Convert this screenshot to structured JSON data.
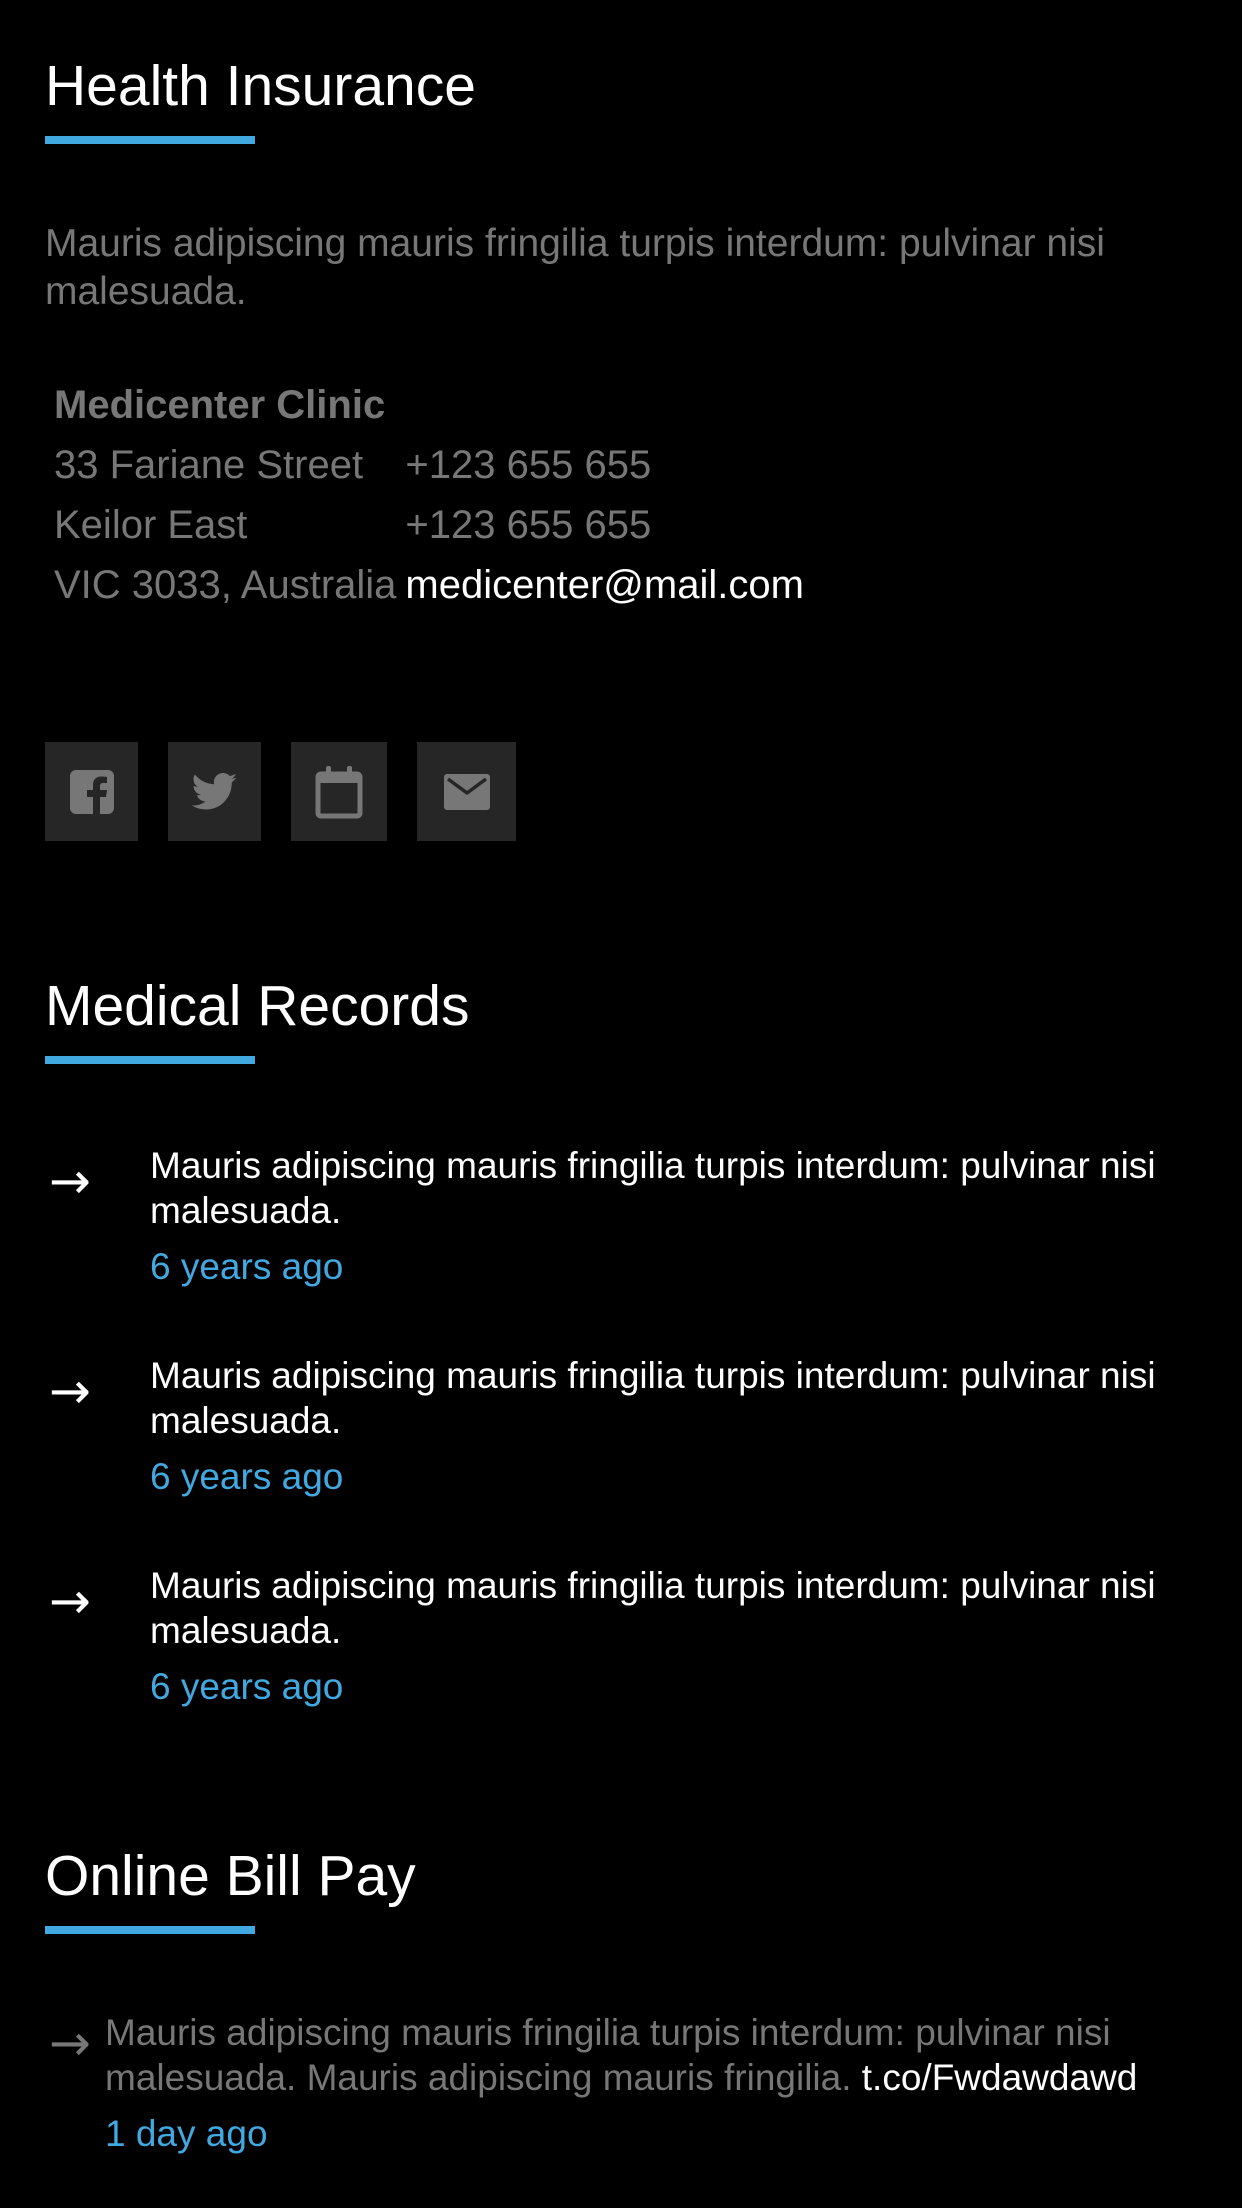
{
  "health_insurance": {
    "title": "Health Insurance",
    "intro": "Mauris adipiscing mauris fringilia turpis interdum: pulvinar nisi malesuada.",
    "clinic": {
      "name": "Medicenter Clinic",
      "address_line1": "33 Fariane Street",
      "address_line2": "Keilor East",
      "address_line3": "VIC 3033, Australia",
      "phone1": "+123 655 655",
      "phone2": "+123 655 655",
      "email": "medicenter@mail.com"
    },
    "social_icons": [
      "facebook-icon",
      "twitter-icon",
      "calendar-icon",
      "mail-icon"
    ]
  },
  "medical_records": {
    "title": "Medical Records",
    "items": [
      {
        "text": "Mauris adipiscing mauris fringilia turpis interdum: pulvinar nisi malesuada.",
        "time": "6 years ago"
      },
      {
        "text": "Mauris adipiscing mauris fringilia turpis interdum: pulvinar nisi malesuada.",
        "time": "6 years ago"
      },
      {
        "text": "Mauris adipiscing mauris fringilia turpis interdum: pulvinar nisi malesuada.",
        "time": "6 years ago"
      }
    ],
    "arrow": "→"
  },
  "online_bill_pay": {
    "title": "Online Bill Pay",
    "arrow": "→",
    "text": "Mauris adipiscing mauris fringilia turpis interdum: pulvinar nisi malesuada. Mauris adipiscing mauris fringilia.",
    "link": "t.co/Fwdawdawd",
    "time": "1 day ago"
  },
  "colors": {
    "background": "#000000",
    "accent": "#42a8e0",
    "muted_text": "#777777",
    "icon_box": "#262626"
  }
}
